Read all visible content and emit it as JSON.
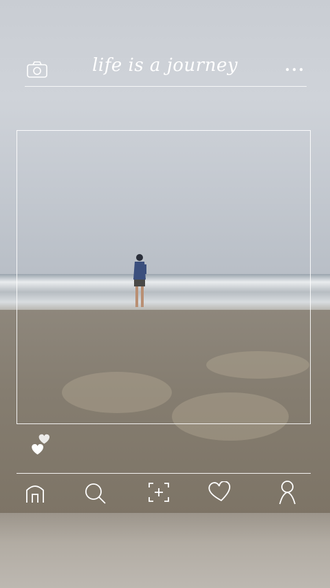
{
  "header": {
    "title": "life is a journey"
  },
  "icons": {
    "camera": "camera-icon",
    "more": "more-dots-icon",
    "hearts": "double-heart-icon",
    "home": "home-icon",
    "search": "search-icon",
    "add": "add-post-icon",
    "activity": "heart-icon",
    "profile": "profile-icon"
  },
  "colors": {
    "overlay": "#ffffff"
  }
}
